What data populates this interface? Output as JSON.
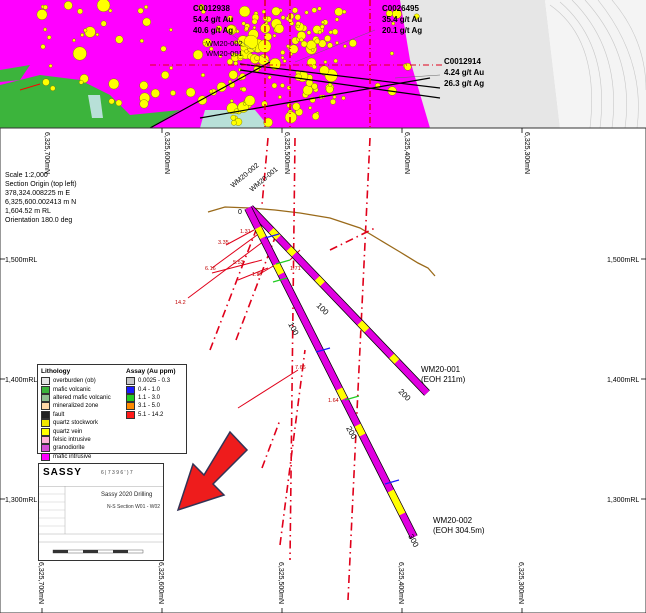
{
  "plan": {
    "samples": [
      {
        "id": "C0012938",
        "au": "54.4 g/t Au",
        "ag": "40.6 g/t Ag"
      },
      {
        "id": "C0026495",
        "au": "35.4 g/t Au",
        "ag": "20.1 g/t Ag"
      },
      {
        "id": "C0012914",
        "au": "4.24 g/t Au",
        "ag": "26.3 g/t Ag"
      }
    ],
    "holes": [
      "WM20-002",
      "WM20-001"
    ]
  },
  "northings_top": [
    "6,325,700mN",
    "6,325,600mN",
    "6,325,500mN",
    "6,325,400mN",
    "6,325,300mN"
  ],
  "northings_bottom": [
    "6,325,700mN",
    "6,325,600mN",
    "6,325,500mN",
    "6,325,400mN",
    "6,325,300mN"
  ],
  "info": {
    "scale": "Scale 1:2,000",
    "origin": "Section Origin (top left)",
    "e": "378,324.008225 m E",
    "n": "6,325,600.002413 m N",
    "rl": "1,604.52 m RL",
    "orientation": "Orientation 180.0 deg"
  },
  "rl_labels": [
    "1,500mRL",
    "1,400mRL",
    "1,300mRL"
  ],
  "section": {
    "hole_top_labels": [
      "WM20-002",
      "WM20-001"
    ],
    "zero": "0",
    "depth_labels": [
      "100",
      "100",
      "200",
      "200",
      "300"
    ],
    "hole1_end": [
      "WM20-001",
      "(EOH 211m)"
    ],
    "hole2_end": [
      "WM20-002",
      "(EOH 304.5m)"
    ],
    "intercepts": [
      "3.35",
      "1.31",
      "6.16",
      "5.53",
      "1.87",
      "14.2",
      "7.66",
      "1.64",
      "1.71"
    ]
  },
  "legend": {
    "lith_title": "Lithology",
    "lith_items": [
      {
        "label": "overburden (ob)",
        "color": "#e6e6e6"
      },
      {
        "label": "mafic volcanic",
        "color": "#3cb43c"
      },
      {
        "label": "altered mafic volcanic",
        "color": "#8fbf8f"
      },
      {
        "label": "mineralized zone",
        "color": "#ffd8a8"
      },
      {
        "label": "fault",
        "color": "#222222"
      },
      {
        "label": "quartz stockwork",
        "color": "#f2e600"
      },
      {
        "label": "quartz vein",
        "color": "#ffff00"
      },
      {
        "label": "felsic intrusive",
        "color": "#ffb0d8"
      },
      {
        "label": "granodiorite",
        "color": "#d54fd5"
      },
      {
        "label": "mafic intrusive",
        "color": "#ff00ff"
      }
    ],
    "assay_title": "Assay (Au ppm)",
    "assay_items": [
      {
        "label": "0.0025 - 0.3",
        "color": "#c8c8c8"
      },
      {
        "label": "0.4 - 1.0",
        "color": "#1a1aff"
      },
      {
        "label": "1.1 - 3.0",
        "color": "#22cc22"
      },
      {
        "label": "3.1 - 5.0",
        "color": "#ff8a00"
      },
      {
        "label": "5.1 - 14.2",
        "color": "#ff1a1a"
      }
    ]
  },
  "titleblock": {
    "logo": "SASSY",
    "code": "6 | 7 3 9 6 ' ) 7",
    "title": "Sassy 2020 Drilling",
    "subtitle": "N-S Section W01 - W02"
  },
  "colors": {
    "magenta": "#ff00ff",
    "drill_trace": "#cc00cc",
    "gold": "#ffff00",
    "fault": "#e0001a",
    "topo": "#9a6a1a"
  }
}
